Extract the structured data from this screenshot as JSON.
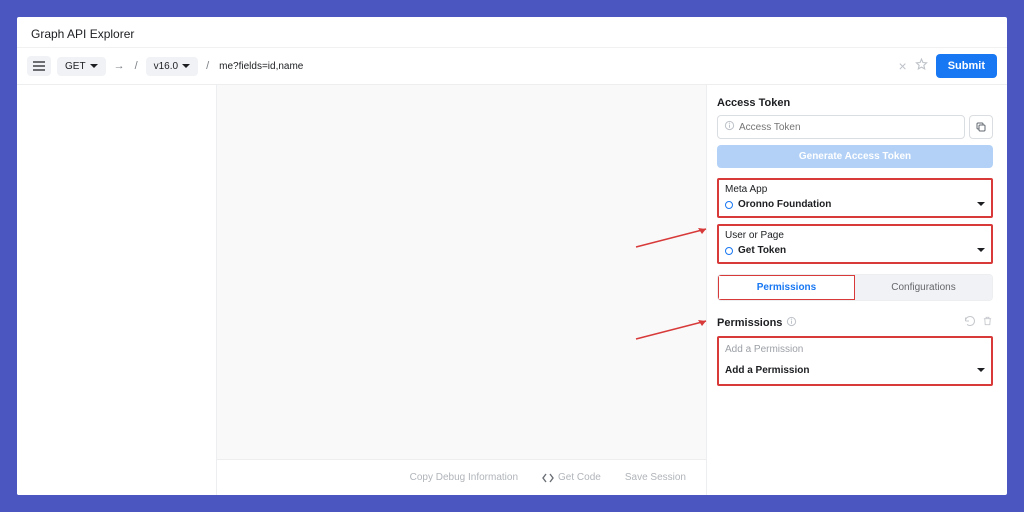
{
  "title": "Graph API Explorer",
  "toolbar": {
    "method": "GET",
    "version": "v16.0",
    "query": "me?fields=id,name",
    "submit_label": "Submit"
  },
  "footer": {
    "copy_debug": "Copy Debug Information",
    "get_code": "Get Code",
    "save_session": "Save Session"
  },
  "access_token": {
    "label": "Access Token",
    "placeholder": "Access Token",
    "generate_label": "Generate Access Token"
  },
  "meta_app": {
    "label": "Meta App",
    "value": "Oronno Foundation"
  },
  "user_page": {
    "label": "User or Page",
    "value": "Get Token"
  },
  "tabs": {
    "permissions": "Permissions",
    "configurations": "Configurations"
  },
  "permissions": {
    "header": "Permissions",
    "placeholder": "Add a Permission",
    "add_label": "Add a Permission"
  }
}
